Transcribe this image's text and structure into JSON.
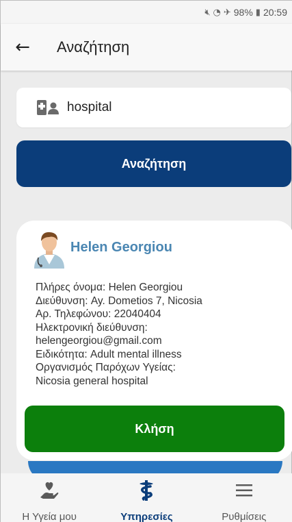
{
  "status_bar": {
    "battery": "98%",
    "time": "20:59",
    "icons": [
      "mute-icon",
      "wifi-icon",
      "airplane-icon",
      "battery-icon"
    ]
  },
  "app_bar": {
    "title": "Αναζήτηση",
    "back_icon": "back-arrow-icon"
  },
  "search": {
    "value": "hospital",
    "icon": "doctor-id-icon",
    "button_label": "Αναζήτηση"
  },
  "result": {
    "name": "Helen Georgiou",
    "avatar_icon": "doctor-avatar-icon",
    "details": [
      "Πλήρες όνομα:  Helen Georgiou",
      "Διεύθυνση:  Ay. Dometios 7, Nicosia",
      "Αρ. Τηλεφώνου:  22040404",
      "Ηλεκτρονική διεύθυνση:",
      "helengeorgiou@gmail.com",
      "Ειδικότητα:  Adult mental illness",
      "Οργανισμός Παρόχων Υγείας:",
      "Nicosia general hospital"
    ],
    "call_label": "Κλήση"
  },
  "bottom_nav": {
    "items": [
      {
        "label": "Η Υγεία μου",
        "icon": "hand-heart-icon",
        "active": false
      },
      {
        "label": "Υπηρεσίες",
        "icon": "medical-caduceus-icon",
        "active": true
      },
      {
        "label": "Ρυθμίσεις",
        "icon": "menu-icon",
        "active": false
      }
    ]
  },
  "colors": {
    "primary": "#0b3d7a",
    "call": "#0c7f0c",
    "name": "#4a86b2",
    "background": "#ececec"
  }
}
